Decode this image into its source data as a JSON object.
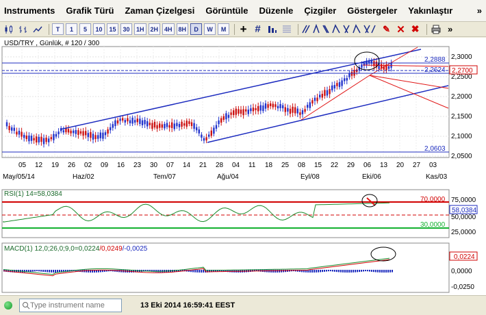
{
  "menu": {
    "items": [
      "Instruments",
      "Grafik Türü",
      "Zaman Çizelgesi",
      "Görüntüle",
      "Düzenle",
      "Çizgiler",
      "Göstergeler",
      "Yakınlaştır"
    ],
    "more": "»"
  },
  "toolbar": {
    "timeframes": [
      "T",
      "1",
      "5",
      "10",
      "15",
      "30",
      "1H",
      "2H",
      "4H",
      "8H",
      "D",
      "W",
      "M"
    ],
    "active_timeframe": "D",
    "icons": [
      "candle-chart-icon",
      "bar-chart-icon",
      "line-chart-icon",
      "crosshair-icon",
      "grid-icon",
      "tools-icon",
      "fibonacci-icon",
      "pencil-icon",
      "eraser-icon",
      "delete-icon",
      "delete-all-icon",
      "print-icon",
      "more-icon"
    ]
  },
  "chart": {
    "header": "USD/TRY , Günlük, # 120 / 300",
    "price_axis": [
      "2,3000",
      "2,2500",
      "2,2000",
      "2,1500",
      "2,1000",
      "2,0500"
    ],
    "levels": {
      "resistance": "2,2888",
      "support_mid": "2,2624",
      "current": "2,2700",
      "low": "2,0603"
    },
    "day_ticks": [
      "05",
      "12",
      "19",
      "26",
      "02",
      "09",
      "16",
      "23",
      "30",
      "07",
      "14",
      "21",
      "28",
      "04",
      "11",
      "18",
      "25",
      "08",
      "15",
      "22",
      "29",
      "06",
      "13",
      "20",
      "27",
      "03"
    ],
    "month_labels": [
      "May/05/14",
      "Haz/02",
      "Tem/07",
      "Ağu/04",
      "Eyl/08",
      "Eki/06",
      "Kas/03"
    ],
    "colors": {
      "up": "#2233cc",
      "down": "#cc1111",
      "channel": "#1c2bbf",
      "fan": "#e01515"
    }
  },
  "rsi": {
    "label": "RSI(1) 14=58,0384",
    "axis": [
      "75,0000",
      "50,0000",
      "25,0000"
    ],
    "overbought": "70,0000",
    "oversold": "30,0000",
    "current": "58,0384"
  },
  "macd": {
    "label_prefix": "MACD(1) 12,0;26,0;9,0=",
    "label_v1": "0,0224",
    "label_v2": "/0,0249",
    "label_v3": "/-0,0025",
    "axis": [
      "0,0000",
      "-0,0250"
    ],
    "current": "0,0224"
  },
  "status": {
    "search_placeholder": "Type instrument name",
    "datetime": "13 Eki 2014 16:59:41 EEST"
  }
}
